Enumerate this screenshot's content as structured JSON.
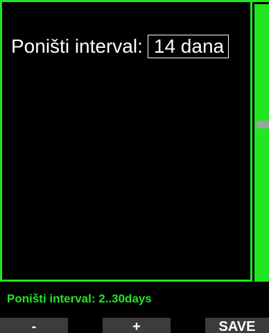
{
  "setting": {
    "label": "Poništi interval:",
    "value": "14 dana"
  },
  "help": {
    "text": "Poništi interval: 2..30days"
  },
  "buttons": {
    "minus": "-",
    "plus": "+",
    "save": "SAVE"
  },
  "colors": {
    "accent": "#22e622",
    "background": "#000000",
    "text": "#ffffff",
    "button": "#3c3c3c",
    "scroll_thumb": "#9aa49a"
  }
}
